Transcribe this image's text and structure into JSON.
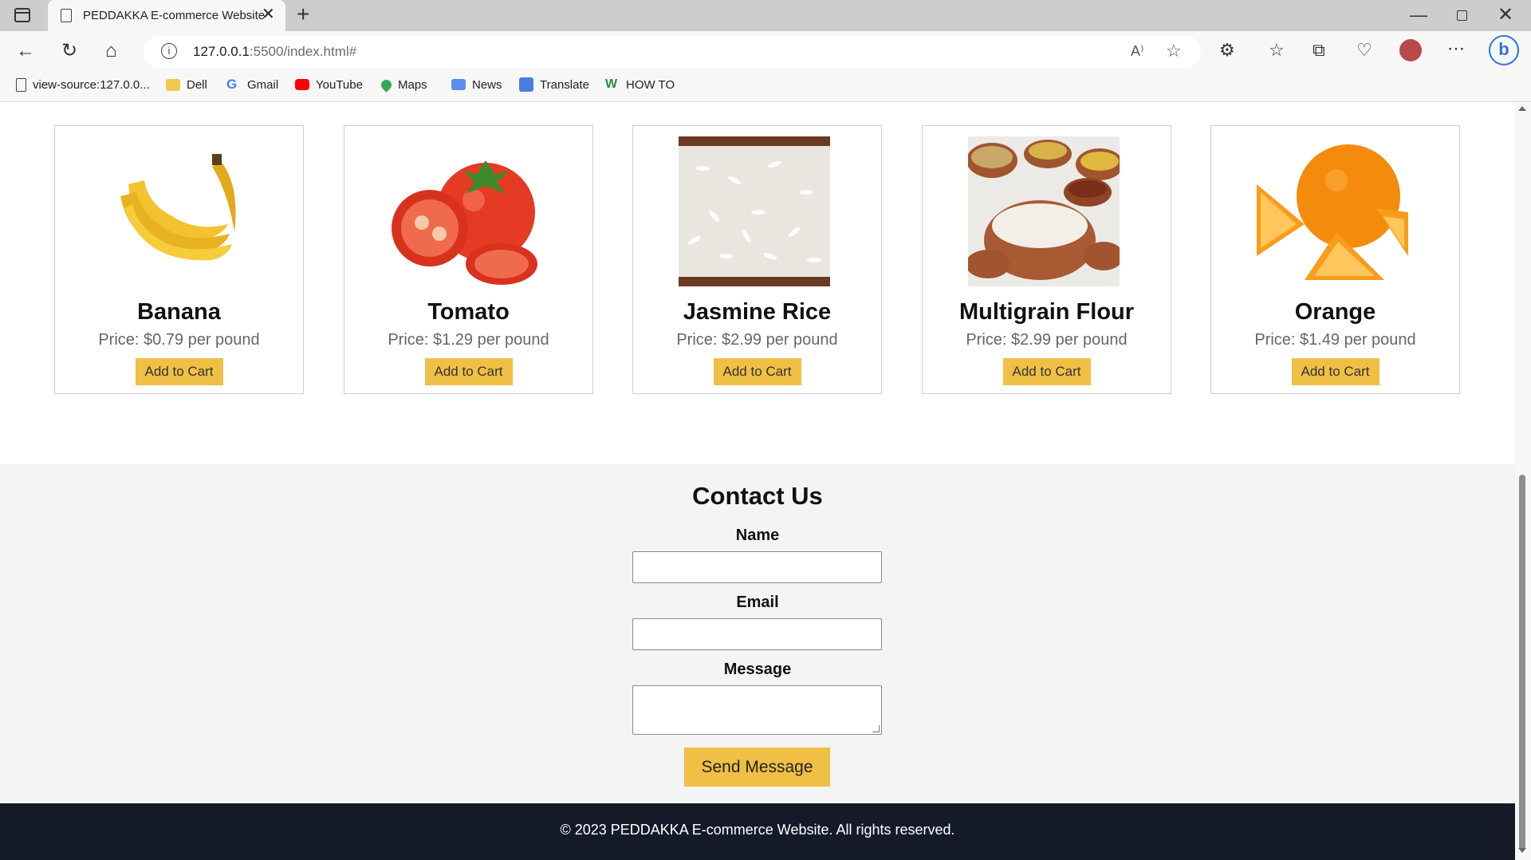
{
  "browser": {
    "tab_title": "PEDDAKKA E-commerce Website",
    "address_host": "127.0.0.1",
    "address_rest": ":5500/index.html#",
    "bookmarks": [
      {
        "label": "view-source:127.0.0...",
        "icon": "page-icon",
        "color": "#444444"
      },
      {
        "label": "Dell",
        "icon": "folder-icon",
        "color": "#f2c94c"
      },
      {
        "label": "Gmail",
        "icon": "google-icon",
        "color": "#4285f4"
      },
      {
        "label": "YouTube",
        "icon": "youtube-icon",
        "color": "#ff0000"
      },
      {
        "label": "Maps",
        "icon": "maps-icon",
        "color": "#34a853"
      },
      {
        "label": "News",
        "icon": "news-icon",
        "color": "#5b8def"
      },
      {
        "label": "Translate",
        "icon": "translate-icon",
        "color": "#4a7fe0"
      },
      {
        "label": "HOW TO",
        "icon": "wikihow-icon",
        "color": "#2e8b3e"
      }
    ]
  },
  "products": [
    {
      "name": "Banana",
      "price": "Price: $0.79 per pound",
      "button": "Add to Cart",
      "image": "banana-image"
    },
    {
      "name": "Tomato",
      "price": "Price: $1.29 per pound",
      "button": "Add to Cart",
      "image": "tomato-image"
    },
    {
      "name": "Jasmine Rice",
      "price": "Price: $2.99 per pound",
      "button": "Add to Cart",
      "image": "rice-image"
    },
    {
      "name": "Multigrain Flour",
      "price": "Price: $2.99 per pound",
      "button": "Add to Cart",
      "image": "flour-image"
    },
    {
      "name": "Orange",
      "price": "Price: $1.49 per pound",
      "button": "Add to Cart",
      "image": "orange-image"
    }
  ],
  "contact": {
    "title": "Contact Us",
    "name_label": "Name",
    "email_label": "Email",
    "message_label": "Message",
    "name_value": "",
    "email_value": "",
    "message_value": "",
    "submit_label": "Send Message"
  },
  "footer": {
    "text": "© 2023 PEDDAKKA E-commerce Website. All rights reserved."
  },
  "colors": {
    "accent": "#f0bf45",
    "footer_bg": "#141a27",
    "contact_bg": "#f4f4f4"
  }
}
